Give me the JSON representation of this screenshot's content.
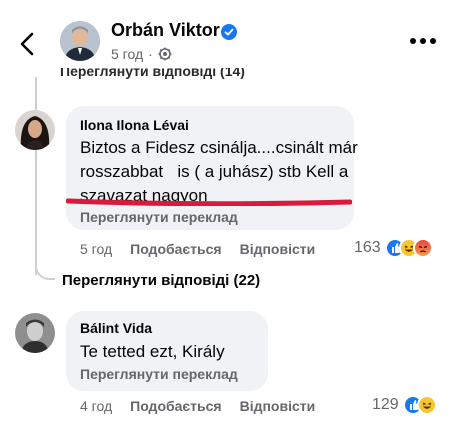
{
  "header": {
    "author": "Orbán Viktor",
    "time": "5 год",
    "privacy_icon": "globe-gear-icon"
  },
  "partial_replies": "Переглянути відповіді (14)",
  "comment1": {
    "author": "Ilona Ilona Lévai",
    "text_lines": [
      "Biztos a Fidesz csinálja....csinált már",
      "rosszabbat   is ( a juhász) stb Kell a",
      "szavazat nagyon"
    ],
    "translate": "Переглянути переклад",
    "time": "5 год",
    "like": "Подобається",
    "reply": "Відповісти",
    "reaction_count": "163",
    "reactions": [
      "like",
      "haha",
      "angry"
    ]
  },
  "view_replies": "Переглянути відповіді (22)",
  "comment2": {
    "author": "Bálint Vida",
    "text": "Te tetted ezt, Király",
    "translate": "Переглянути переклад",
    "time": "4 год",
    "like": "Подобається",
    "reply": "Відповісти",
    "reaction_count": "129",
    "reactions": [
      "like",
      "haha"
    ]
  },
  "colors": {
    "secondary_text": "#65676b",
    "bubble": "#f0f2f5",
    "verified": "#1877f2",
    "highlight": "#d81b3c"
  }
}
